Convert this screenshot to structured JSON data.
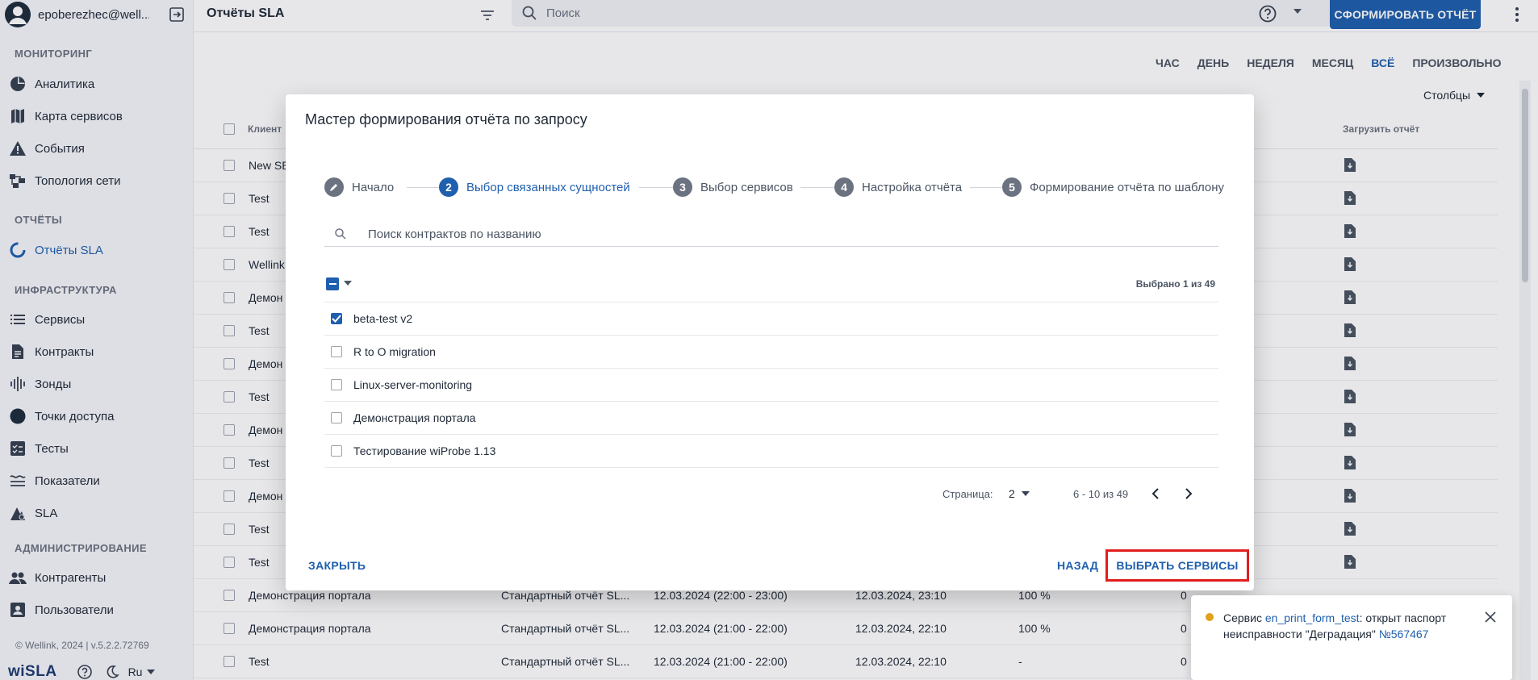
{
  "user": {
    "email": "epoberezhec@well..."
  },
  "sidebar": {
    "sections": [
      {
        "title": "МОНИТОРИНГ",
        "items": [
          {
            "label": "Аналитика",
            "icon": "pie-chart-icon"
          },
          {
            "label": "Карта сервисов",
            "icon": "map-icon"
          },
          {
            "label": "События",
            "icon": "warning-icon"
          },
          {
            "label": "Топология сети",
            "icon": "topology-icon"
          }
        ]
      },
      {
        "title": "ОТЧЁТЫ",
        "items": [
          {
            "label": "Отчёты SLA",
            "icon": "report-icon",
            "active": true
          }
        ]
      },
      {
        "title": "ИНФРАСТРУКТУРА",
        "items": [
          {
            "label": "Сервисы",
            "icon": "list-icon"
          },
          {
            "label": "Контракты",
            "icon": "document-icon"
          },
          {
            "label": "Зонды",
            "icon": "probe-icon"
          },
          {
            "label": "Точки доступа",
            "icon": "circle-icon"
          },
          {
            "label": "Тесты",
            "icon": "checklist-icon"
          },
          {
            "label": "Показатели",
            "icon": "metrics-icon"
          },
          {
            "label": "SLA",
            "icon": "sla-icon"
          }
        ]
      },
      {
        "title": "АДМИНИСТРИРОВАНИЕ",
        "items": [
          {
            "label": "Контрагенты",
            "icon": "people-icon"
          },
          {
            "label": "Пользователи",
            "icon": "user-card-icon"
          }
        ]
      }
    ],
    "footer": "© Wellink, 2024 | v.5.2.2.72769",
    "logo": "wiSLA",
    "language": "Ru"
  },
  "header": {
    "title": "Отчёты SLA",
    "search_placeholder": "Поиск",
    "primary_button": "СФОРМИРОВАТЬ ОТЧЁТ"
  },
  "main": {
    "range_tabs": [
      "ЧАС",
      "ДЕНЬ",
      "НЕДЕЛЯ",
      "МЕСЯЦ",
      "ВСЁ",
      "ПРОИЗВОЛЬНО"
    ],
    "active_range": "ВСЁ",
    "columns_label": "Столбцы",
    "table": {
      "header_client": "Клиент",
      "header_load": "Загрузить отчёт",
      "rows": [
        {
          "client": "New SE"
        },
        {
          "client": "Test"
        },
        {
          "client": "Test"
        },
        {
          "client": "Wellink"
        },
        {
          "client": "Демон"
        },
        {
          "client": "Test"
        },
        {
          "client": "Демон"
        },
        {
          "client": "Test"
        },
        {
          "client": "Демон"
        },
        {
          "client": "Test"
        },
        {
          "client": "Демон"
        },
        {
          "client": "Test"
        },
        {
          "client": "Test"
        },
        {
          "client": "Демонстрация портала",
          "type": "Стандартный отчёт SL...",
          "period": "12.03.2024 (22:00 - 23:00)",
          "created": "12.03.2024, 23:10",
          "value": "100 %",
          "extra": "0"
        },
        {
          "client": "Демонстрация портала",
          "type": "Стандартный отчёт SL...",
          "period": "12.03.2024 (21:00 - 22:00)",
          "created": "12.03.2024, 22:10",
          "value": "100 %",
          "extra": "0"
        },
        {
          "client": "Test",
          "type": "Стандартный отчёт SL...",
          "period": "12.03.2024 (21:00 - 22:00)",
          "created": "12.03.2024, 22:10",
          "value": "-",
          "extra": "0"
        }
      ]
    }
  },
  "modal": {
    "title": "Мастер формирования отчёта по запросу",
    "steps": [
      {
        "num": "",
        "label": "Начало",
        "state": "done"
      },
      {
        "num": "2",
        "label": "Выбор связанных сущностей",
        "state": "active"
      },
      {
        "num": "3",
        "label": "Выбор сервисов",
        "state": "pending"
      },
      {
        "num": "4",
        "label": "Настройка отчёта",
        "state": "pending"
      },
      {
        "num": "5",
        "label": "Формирование отчёта по шаблону",
        "state": "pending"
      }
    ],
    "search_placeholder": "Поиск контрактов по названию",
    "selected_count": "Выбрано 1 из 49",
    "contracts": [
      {
        "name": "beta-test v2",
        "checked": true
      },
      {
        "name": "R to O migration",
        "checked": false
      },
      {
        "name": "Linux-server-monitoring",
        "checked": false
      },
      {
        "name": "Демонстрация портала",
        "checked": false
      },
      {
        "name": "Тестирование wiProbe 1.13",
        "checked": false
      }
    ],
    "pagination": {
      "page_label": "Страница:",
      "page": "2",
      "range": "6 - 10 из 49"
    },
    "close_label": "ЗАКРЫТЬ",
    "back_label": "НАЗАД",
    "next_label": "ВЫБРАТЬ СЕРВИСЫ"
  },
  "toast": {
    "prefix": "Сервис",
    "service_link": "en_print_form_test",
    "message": ": открыт паспорт неисправности \"Деградация\"",
    "ticket": "№567467",
    "status_color": "#e0a21b"
  },
  "colors": {
    "accent": "#1f5fae",
    "highlight": "#e11d1d"
  }
}
